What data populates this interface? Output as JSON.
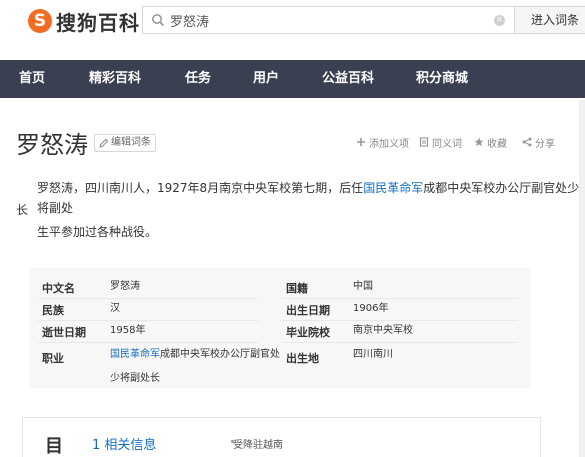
{
  "header": {
    "logo_mark": "S",
    "logo_text": "搜狗百科",
    "search_value": "罗怒涛",
    "enter_label": "进入词条"
  },
  "nav": {
    "items": [
      "首页",
      "精彩百科",
      "任务",
      "用户",
      "公益百科",
      "积分商城"
    ]
  },
  "entry": {
    "title": "罗怒涛",
    "edit_label": "编辑词条",
    "actions": [
      "添加义项",
      "同义词",
      "收藏",
      "分享"
    ]
  },
  "summary": {
    "line1_pre": "罗怒涛，四川南川人，1927年8月南京中央军校第七期，后任",
    "line1_link": "国民革命军",
    "line1_post": "成都中央军校办公厅副官处少将副处",
    "line2": "长",
    "line3": "生平参加过各种战役。"
  },
  "infobox": {
    "left": [
      {
        "label": "中文名",
        "value": "罗怒涛"
      },
      {
        "label": "民族",
        "value": "汉"
      },
      {
        "label": "逝世日期",
        "value": "1958年"
      },
      {
        "label": "职业",
        "value_link": "国民革命军",
        "value": "成都中央军校办公厅副官处",
        "value2": "少将副处长"
      }
    ],
    "right": [
      {
        "label": "国籍",
        "value": "中国"
      },
      {
        "label": "出生日期",
        "value": "1906年"
      },
      {
        "label": "毕业院校",
        "value": "南京中央军校"
      },
      {
        "label": "出生地",
        "value": "四川南川"
      }
    ]
  },
  "toc": {
    "title": "目",
    "item1": "1 相关信息",
    "sub1": "受降驻越南"
  },
  "colors": {
    "nav_bg": "#3a3f51",
    "link": "#136ec2",
    "logo": "#f26d21"
  }
}
